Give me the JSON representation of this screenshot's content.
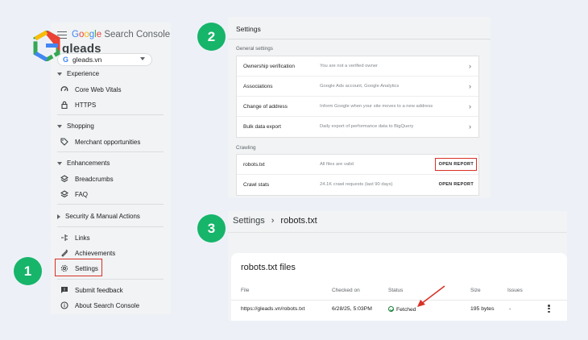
{
  "app": {
    "title_google": "Google",
    "title_sc": "Search Console"
  },
  "brand": {
    "logo_word": "gleads",
    "logo_icon": "gleads-hexagon-logo"
  },
  "property": {
    "icon": "G",
    "name": "gleads.vn"
  },
  "sidebar": {
    "sections": [
      {
        "label": "Experience",
        "items": [
          {
            "label": "Core Web Vitals",
            "icon": "gauge-icon"
          },
          {
            "label": "HTTPS",
            "icon": "lock-icon"
          }
        ]
      },
      {
        "label": "Shopping",
        "items": [
          {
            "label": "Merchant opportunities",
            "icon": "tag-icon"
          }
        ]
      },
      {
        "label": "Enhancements",
        "items": [
          {
            "label": "Breadcrumbs",
            "icon": "layers-icon"
          },
          {
            "label": "FAQ",
            "icon": "layers-icon"
          }
        ]
      },
      {
        "label": "Security & Manual Actions",
        "items": []
      }
    ],
    "bottom_items": [
      {
        "label": "Links",
        "icon": "link-icon"
      },
      {
        "label": "Achievements",
        "icon": "achievement-icon"
      },
      {
        "label": "Settings",
        "icon": "gear-icon"
      }
    ],
    "footer_items": [
      {
        "label": "Submit feedback",
        "icon": "feedback-icon"
      },
      {
        "label": "About Search Console",
        "icon": "info-icon"
      }
    ]
  },
  "steps": [
    "1",
    "2",
    "3"
  ],
  "settings": {
    "title": "Settings",
    "general_label": "General settings",
    "general_rows": [
      {
        "label": "Ownership verification",
        "value": "You are not a verified owner"
      },
      {
        "label": "Associations",
        "value": "Google Ads account, Google Analytics"
      },
      {
        "label": "Change of address",
        "value": "Inform Google when your site moves to a new address"
      },
      {
        "label": "Bulk data export",
        "value": "Daily export of performance data to BigQuery"
      }
    ],
    "crawling_label": "Crawling",
    "crawling_rows": [
      {
        "label": "robots.txt",
        "value": "All files are valid",
        "action": "OPEN REPORT"
      },
      {
        "label": "Crawl stats",
        "value": "24.1K crawl requests (last 90 days)",
        "action": "OPEN REPORT"
      }
    ]
  },
  "robots": {
    "breadcrumb_parent": "Settings",
    "breadcrumb_sep": "›",
    "breadcrumb_current": "robots.txt",
    "card_title": "robots.txt files",
    "headers": {
      "file": "File",
      "checked": "Checked on",
      "status": "Status",
      "size": "Size",
      "issues": "Issues"
    },
    "row": {
      "file": "https://gleads.vn/robots.txt",
      "checked": "6/28/25, 5:03PM",
      "status": "Fetched",
      "size": "195 bytes",
      "issues": "-"
    }
  },
  "colors": {
    "accent_green": "#16b56a",
    "highlight_red": "#d93025",
    "status_green": "#188038"
  }
}
